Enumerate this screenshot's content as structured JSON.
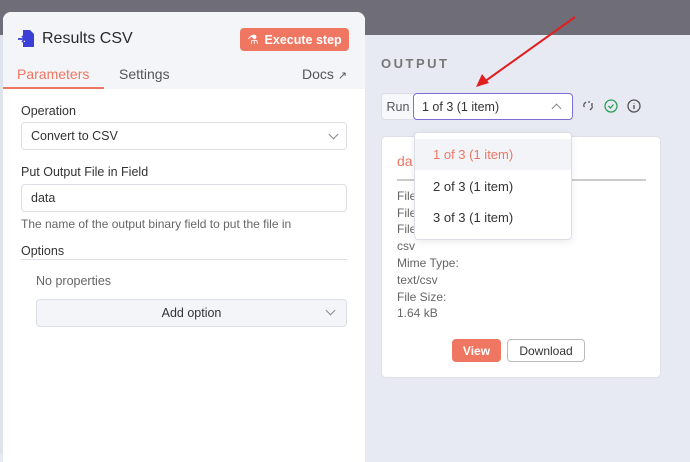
{
  "node": {
    "title": "Results CSV",
    "execute_label": "Execute step",
    "icon": "convert-file-icon"
  },
  "tabs": {
    "parameters": "Parameters",
    "settings": "Settings",
    "docs": "Docs"
  },
  "params": {
    "operation_label": "Operation",
    "operation_value": "Convert to CSV",
    "field_label": "Put Output File in Field",
    "field_value": "data",
    "field_hint": "The name of the output binary field to put the file in",
    "options_label": "Options",
    "no_props": "No properties",
    "add_option": "Add option"
  },
  "output": {
    "heading": "OUTPUT",
    "run_label": "Run",
    "run_selected": "1 of 3 (1 item)",
    "run_options": [
      "1 of 3 (1 item)",
      "2 of 3 (1 item)",
      "3 of 3 (1 item)"
    ],
    "card": {
      "title": "da",
      "lines": [
        "File",
        "File",
        "File",
        "csv",
        "Mime Type:",
        "text/csv",
        "File Size:",
        "1.64 kB"
      ],
      "view": "View",
      "download": "Download"
    }
  },
  "colors": {
    "accent": "#ef7661",
    "selection_border": "#7b6fd6",
    "success": "#2e9e5b",
    "annotation_arrow": "#e02020"
  }
}
